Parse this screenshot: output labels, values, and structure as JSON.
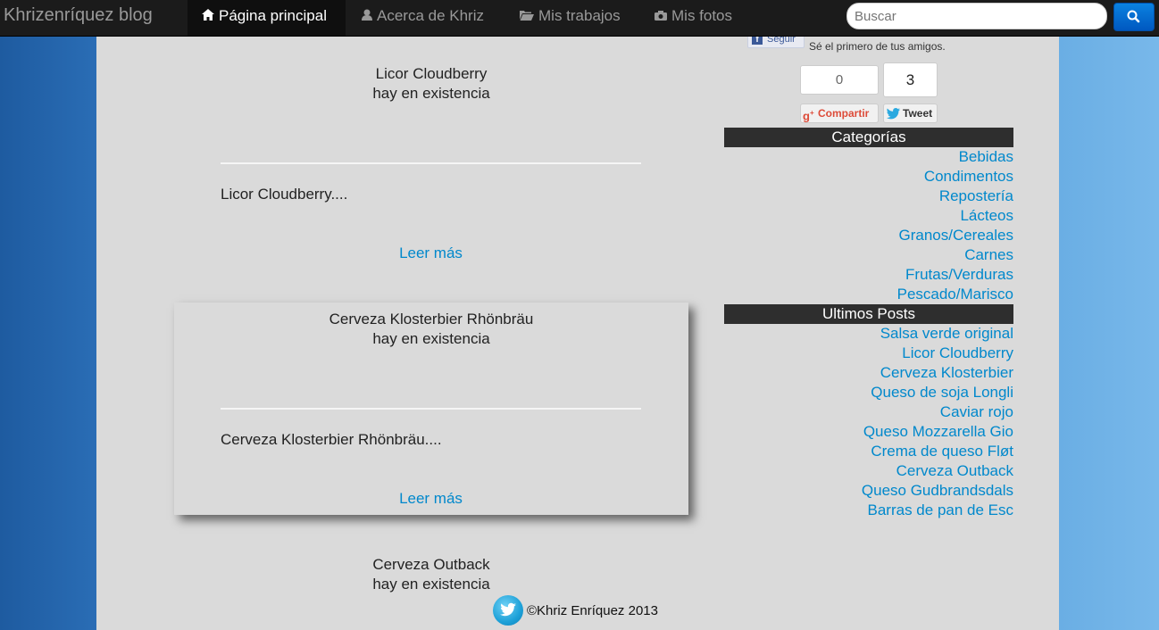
{
  "navbar": {
    "brand": "Khrizenríquez blog",
    "items": [
      {
        "label": "Página principal",
        "icon": "home-icon",
        "active": true
      },
      {
        "label": "Acerca de Khriz",
        "icon": "user-icon",
        "active": false
      },
      {
        "label": "Mis trabajos",
        "icon": "folder-open-icon",
        "active": false
      },
      {
        "label": "Mis fotos",
        "icon": "camera-icon",
        "active": false
      }
    ],
    "search": {
      "placeholder": "Buscar",
      "value": ""
    },
    "search_button_icon": "search-icon"
  },
  "posts": [
    {
      "title": "Licor Cloudberry",
      "availability": "hay en existencia",
      "excerpt": "Licor Cloudberry....",
      "read_more": "Leer más"
    },
    {
      "title": "Cerveza Klosterbier Rhönbräu",
      "availability": "hay en existencia",
      "excerpt": "Cerveza Klosterbier Rhönbräu....",
      "read_more": "Leer más"
    },
    {
      "title": "Cerveza Outback",
      "availability": "hay en existencia"
    }
  ],
  "social": {
    "facebook_follow": "Seguir",
    "facebook_text": "Sé el primero de tus amigos.",
    "gplus_count": "0",
    "tweet_count": "3",
    "gplus_label": "Compartir",
    "tweet_label": "Tweet"
  },
  "sidebar": {
    "categories_title": "Categorías",
    "categories": [
      "Bebidas",
      "Condimentos",
      "Repostería",
      "Lácteos",
      "Granos/Cereales",
      "Carnes",
      "Frutas/Verduras",
      "Pescado/Marisco"
    ],
    "latest_title": "Ultimos Posts",
    "latest_posts": [
      "Salsa verde original",
      "Licor Cloudberry",
      "Cerveza Klosterbier",
      "Queso de soja Longli",
      "Caviar rojo",
      "Queso Mozzarella Gio",
      "Crema de queso Fløt",
      "Cerveza Outback",
      "Queso Gudbrandsdals",
      "Barras de pan de Esc"
    ]
  },
  "footer": {
    "copyright": "©Khriz Enríquez 2013",
    "icon": "twitter-bird-icon"
  },
  "colors": {
    "link": "#0088cc",
    "navbar": "#1b1b1b",
    "content_bg": "#dadada",
    "sidebar_header": "#2e2e2e"
  }
}
